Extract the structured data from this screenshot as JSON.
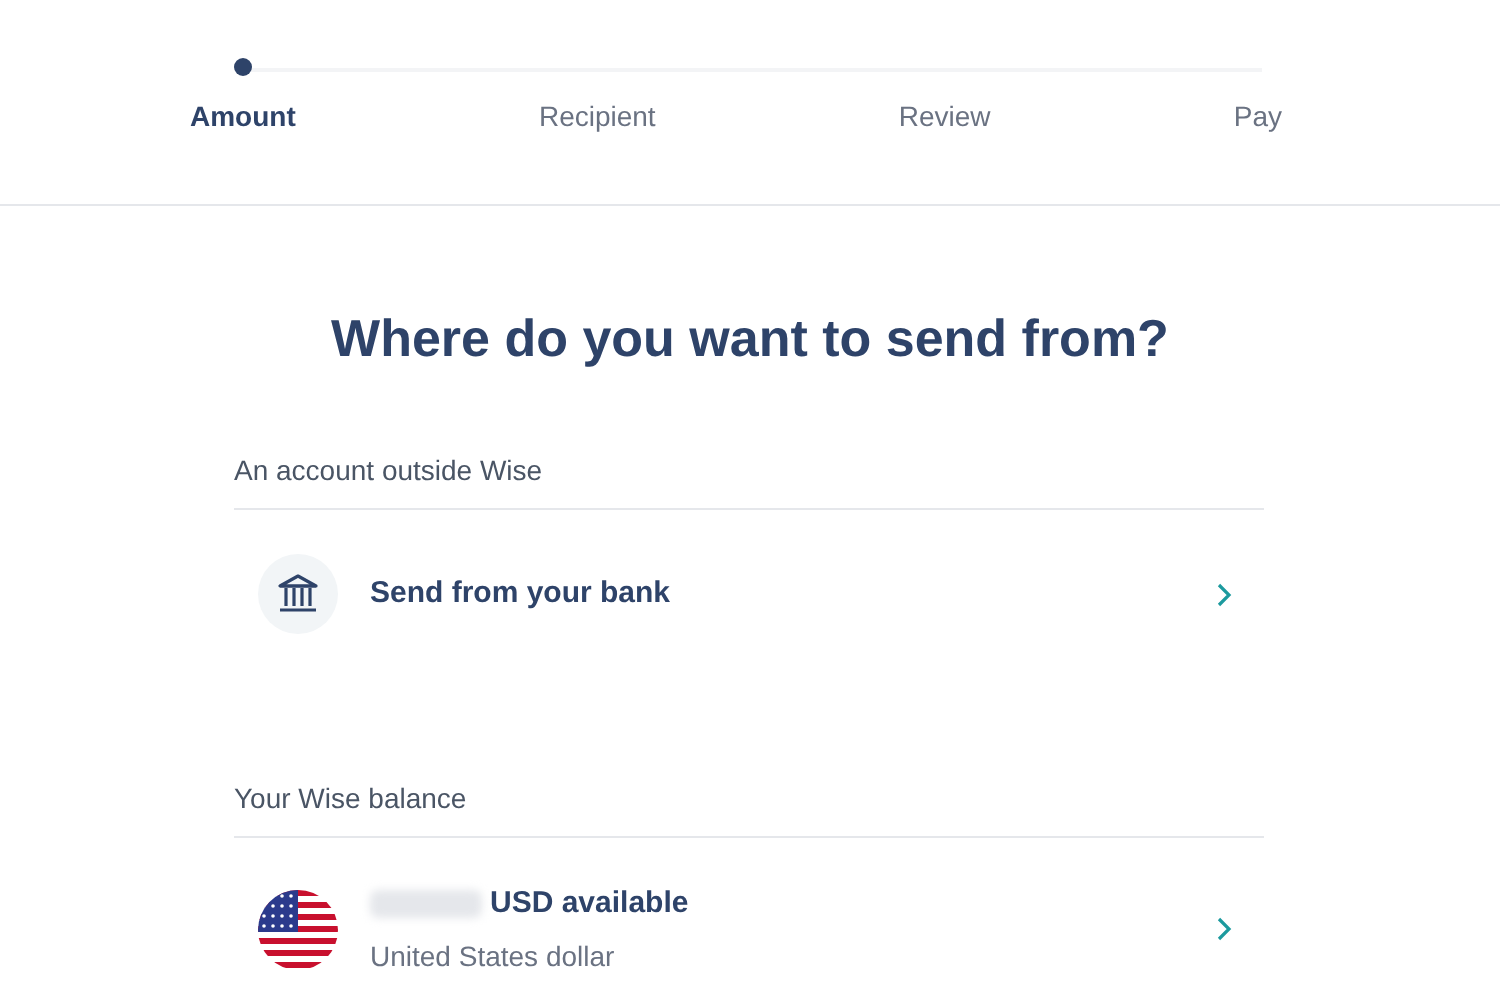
{
  "steps": [
    {
      "label": "Amount",
      "selected": true
    },
    {
      "label": "Recipient",
      "selected": false
    },
    {
      "label": "Review",
      "selected": false
    },
    {
      "label": "Pay",
      "selected": false
    }
  ],
  "title": "Where do you want to send from?",
  "sections": [
    {
      "heading": "An account outside Wise",
      "options": [
        {
          "kind": "bank",
          "title": "Send from your bank"
        }
      ]
    },
    {
      "heading": "Your Wise balance",
      "options": [
        {
          "kind": "balance",
          "title": "USD available",
          "subtitle": "United States dollar"
        }
      ]
    }
  ]
}
